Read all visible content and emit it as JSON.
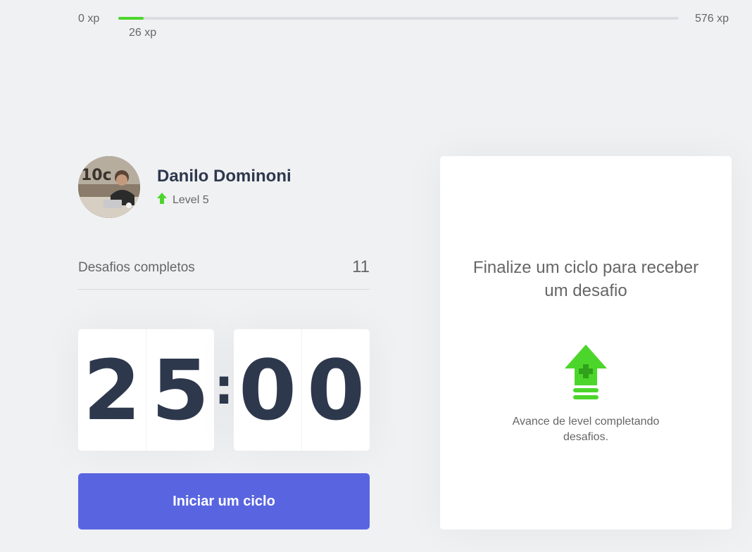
{
  "xp": {
    "min_label": "0 xp",
    "max_label": "576 xp",
    "current_label": "26 xp",
    "current": 26,
    "max": 576,
    "bar_color": "#4CD62B"
  },
  "profile": {
    "name": "Danilo Dominoni",
    "level_label": "Level 5",
    "level_icon": "level-up-arrow-icon"
  },
  "challenges": {
    "label": "Desafios completos",
    "count": "11"
  },
  "countdown": {
    "minute_left": "2",
    "minute_right": "5",
    "separator": ":",
    "second_left": "0",
    "second_right": "0"
  },
  "start_button": {
    "label": "Iniciar um ciclo",
    "color": "#5965E0"
  },
  "challenge_box": {
    "title": "Finalize um ciclo para receber um desafio",
    "hint": "Avance de level completando desafios.",
    "icon": "level-up-icon"
  },
  "colors": {
    "background": "#F0F1F3",
    "title": "#2E384D",
    "text": "#666666",
    "green": "#4CD62B"
  }
}
